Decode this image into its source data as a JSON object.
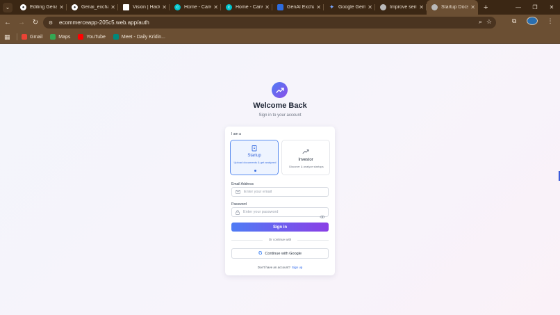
{
  "browser": {
    "tabs": [
      {
        "title": "Editing Genai",
        "icon": "github-icon",
        "color": "#ffffff"
      },
      {
        "title": "Genai_exchang",
        "icon": "github-icon",
        "color": "#ffffff"
      },
      {
        "title": "Vision | Hack",
        "icon": "page-icon",
        "color": "#ffffff"
      },
      {
        "title": "Home - Canv",
        "icon": "canva-icon",
        "color": "#00c4cc"
      },
      {
        "title": "Home - Canv",
        "icon": "canva-icon",
        "color": "#00c4cc"
      },
      {
        "title": "GenAI Exchan",
        "icon": "shield-icon",
        "color": "#2d6cdf"
      },
      {
        "title": "Google Gemi",
        "icon": "gemini-icon",
        "color": "#7aa7ff"
      },
      {
        "title": "Improve sent",
        "icon": "globe-icon",
        "color": "#b9b9b9"
      },
      {
        "title": "Startup Docs",
        "icon": "globe-icon",
        "color": "#b9b9b9",
        "active": true
      }
    ],
    "url": "ecommerceapp-205c5.web.app/auth",
    "bookmarks": [
      {
        "label": "Gmail",
        "icon": "gmail-icon",
        "color": "#ea4335"
      },
      {
        "label": "Maps",
        "icon": "maps-icon",
        "color": "#34a853"
      },
      {
        "label": "YouTube",
        "icon": "youtube-icon",
        "color": "#ff0000"
      },
      {
        "label": "Meet - Daily Kridin...",
        "icon": "meet-icon",
        "color": "#00897b"
      }
    ]
  },
  "auth": {
    "title": "Welcome Back",
    "subtitle": "Sign in to your account",
    "role_label": "I am a",
    "roles": [
      {
        "title": "Startup",
        "desc": "Upload documents & get analyzed",
        "selected": true
      },
      {
        "title": "Investor",
        "desc": "Discover & analyze startups",
        "selected": false
      }
    ],
    "email_label": "Email Address",
    "email_placeholder": "Enter your email",
    "password_label": "Password",
    "password_placeholder": "Enter your password",
    "signin_label": "Sign in",
    "divider_text": "Or continue with",
    "google_label": "Continue with Google",
    "footer_text": "Don't have an account?",
    "signup_label": "Sign up"
  },
  "colors": {
    "accent_start": "#4f7cf5",
    "accent_end": "#8a3fe6",
    "link": "#2563eb"
  }
}
